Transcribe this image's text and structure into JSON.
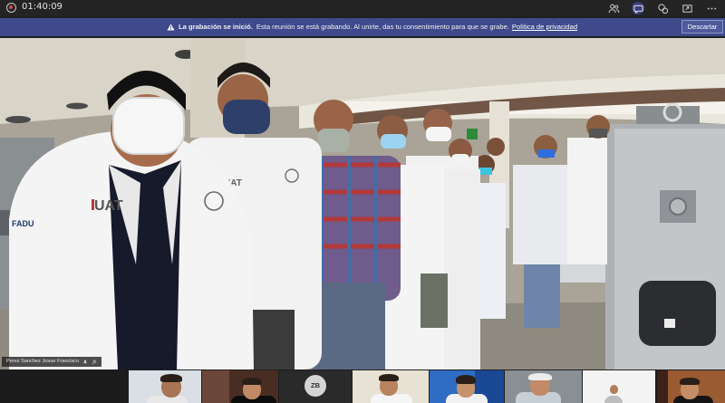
{
  "topbar": {
    "timer": "01:40:09",
    "icons": [
      "participants-icon",
      "chat-icon",
      "reactions-icon",
      "share-icon",
      "more-icon"
    ]
  },
  "banner": {
    "title": "La grabación se inició.",
    "message": "Esta reunión se está grabando. Al unirte, das tu consentimiento para que se grabe.",
    "link": "Política de privacidad",
    "dismiss_label": "Descartar"
  },
  "stage": {
    "logo_left": "UAT",
    "logo_coat": "UAT",
    "badge": "FADU",
    "speaker_name": "Perez Sanchez Josue Francisco"
  },
  "strip": {
    "avatar_initials": "ZB"
  },
  "colors": {
    "topbar": "#242424",
    "banner": "#3e4a8c",
    "accent": "#6264a7"
  }
}
